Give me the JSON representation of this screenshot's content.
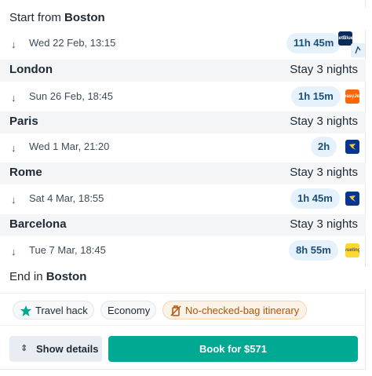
{
  "start": {
    "prefix": "Start from",
    "city": "Boston"
  },
  "end": {
    "prefix": "End in",
    "city": "Boston"
  },
  "segments": [
    {
      "date": "Wed 22 Feb, 13:15",
      "duration": "11h 45m",
      "carrier_icons": [
        "jetblue-logo-icon",
        "connection-icon"
      ]
    },
    {
      "date": "Sun 26 Feb, 18:45",
      "duration": "1h 15m",
      "carrier_icons": [
        "easyjet-logo-icon"
      ]
    },
    {
      "date": "Wed 1 Mar, 21:20",
      "duration": "2h",
      "carrier_icons": [
        "ryanair-logo-icon"
      ]
    },
    {
      "date": "Sat 4 Mar, 18:55",
      "duration": "1h 45m",
      "carrier_icons": [
        "ryanair-logo-icon"
      ]
    },
    {
      "date": "Tue 7 Mar, 18:45",
      "duration": "8h 55m",
      "carrier_icons": [
        "vueling-logo-icon"
      ]
    }
  ],
  "stops": [
    {
      "city": "London",
      "stay": "Stay 3 nights"
    },
    {
      "city": "Paris",
      "stay": "Stay 3 nights"
    },
    {
      "city": "Rome",
      "stay": "Stay 3 nights"
    },
    {
      "city": "Barcelona",
      "stay": "Stay 3 nights"
    }
  ],
  "logos": {
    "jetblue": "jetBlue",
    "easyjet": "easyJet",
    "vueling": "vueling"
  },
  "tags": {
    "travel_hack": "Travel hack",
    "economy": "Economy",
    "no_bag": "No-checked-bag itinerary"
  },
  "buttons": {
    "details": "Show details",
    "book": "Book for $571"
  },
  "colors": {
    "accent": "#00a991",
    "duration_badge_bg": "#e6f2fb",
    "warning": "#b45309"
  }
}
